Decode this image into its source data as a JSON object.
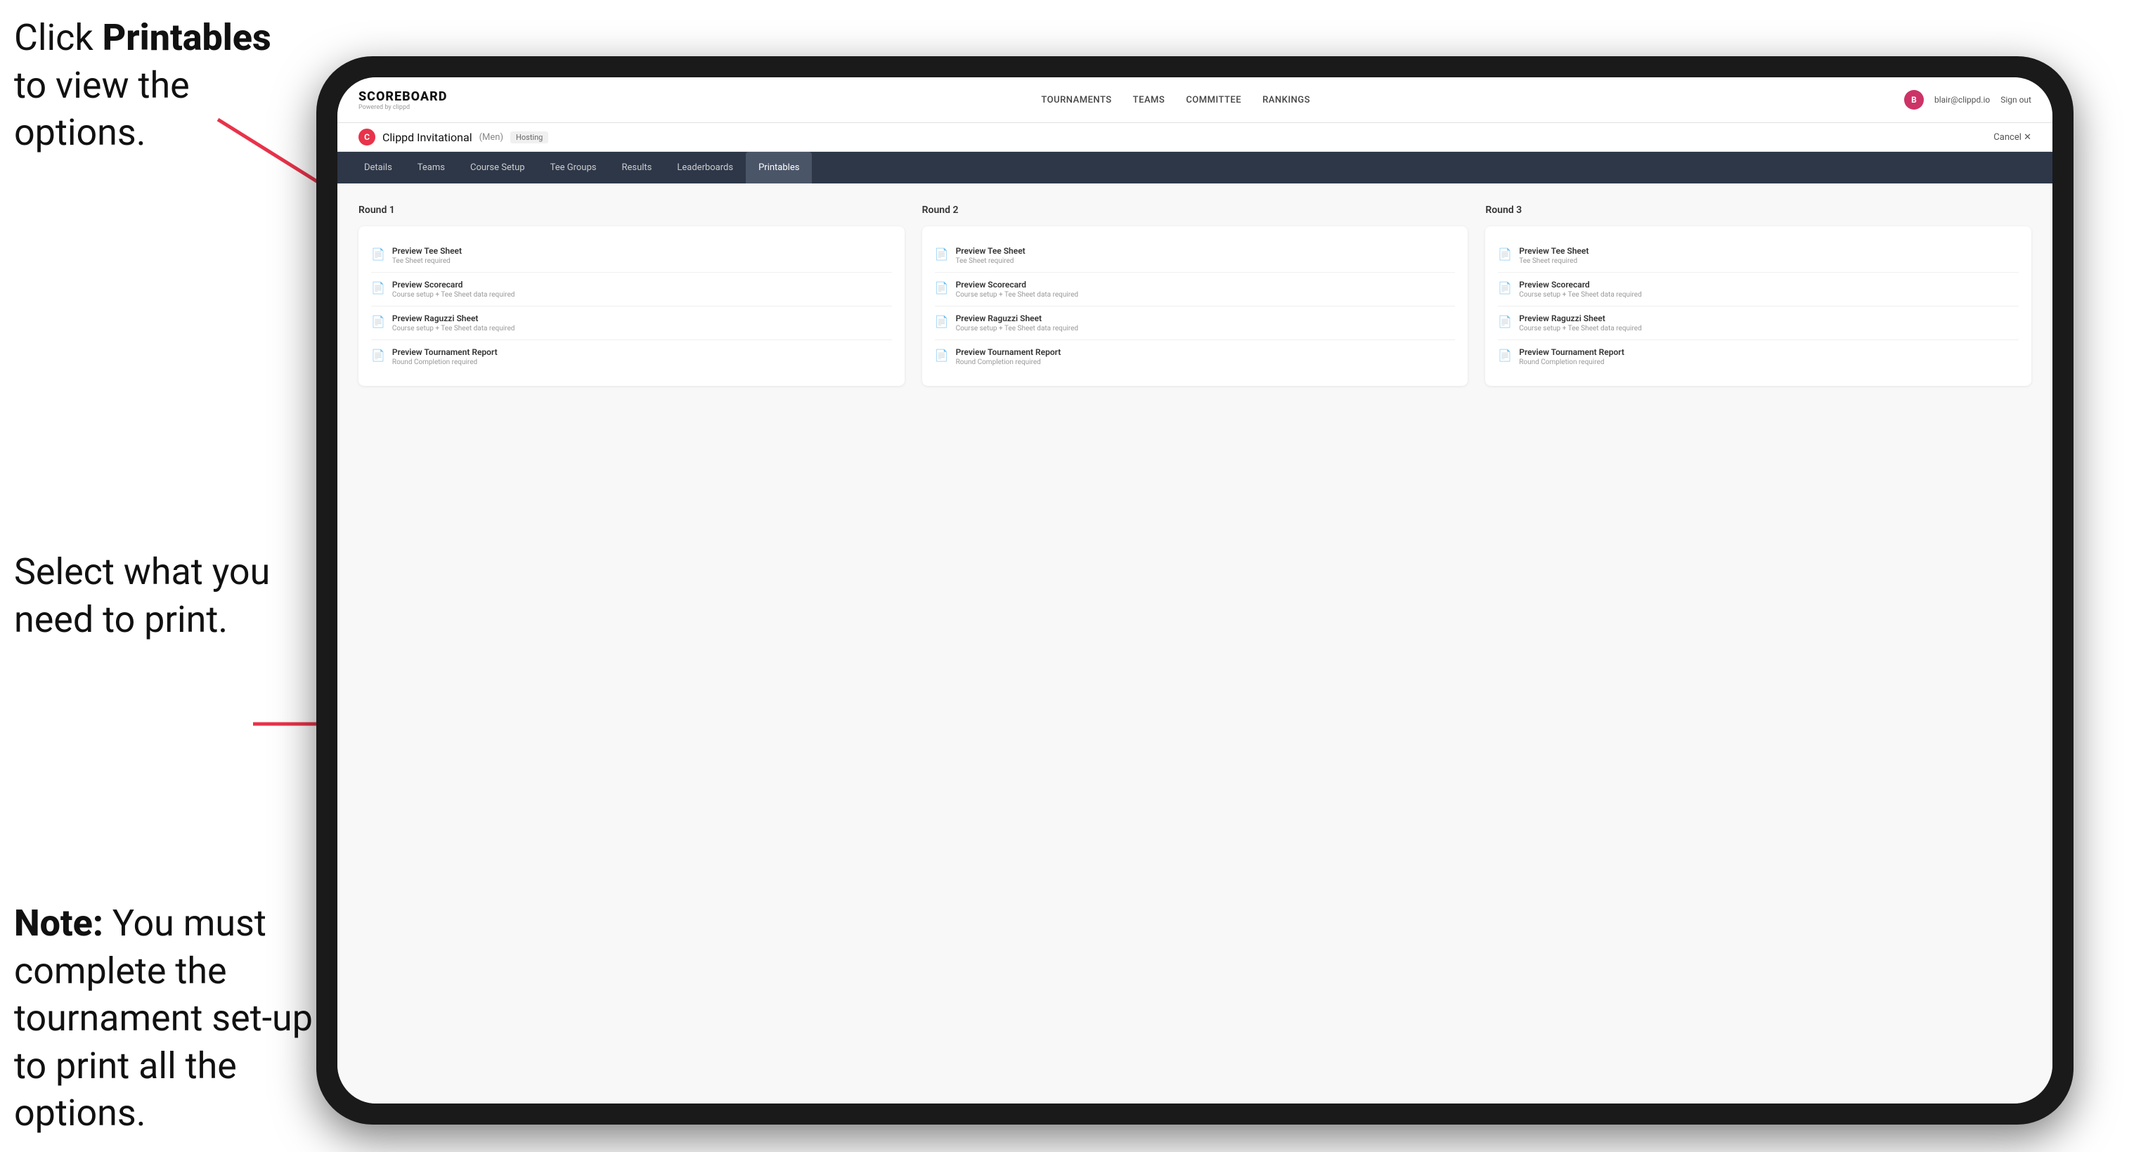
{
  "annotations": {
    "top": {
      "prefix": "Click ",
      "bold": "Printables",
      "suffix": " to view the options."
    },
    "middle": {
      "text": "Select what you need to print."
    },
    "bottom": {
      "bold": "Note:",
      "suffix": " You must complete the tournament set-up to print all the options."
    }
  },
  "nav": {
    "logo": "SCOREBOARD",
    "logo_sub": "Powered by clippd",
    "items": [
      "TOURNAMENTS",
      "TEAMS",
      "COMMITTEE",
      "RANKINGS"
    ],
    "user_email": "blair@clippd.io",
    "sign_out": "Sign out"
  },
  "tournament": {
    "name": "Clippd Invitational",
    "bracket": "(Men)",
    "status": "Hosting",
    "cancel": "Cancel  ✕"
  },
  "tabs": [
    {
      "label": "Details",
      "active": false
    },
    {
      "label": "Teams",
      "active": false
    },
    {
      "label": "Course Setup",
      "active": false
    },
    {
      "label": "Tee Groups",
      "active": false
    },
    {
      "label": "Results",
      "active": false
    },
    {
      "label": "Leaderboards",
      "active": false
    },
    {
      "label": "Printables",
      "active": true
    }
  ],
  "rounds": [
    {
      "title": "Round 1",
      "items": [
        {
          "label": "Preview Tee Sheet",
          "sublabel": "Tee Sheet required"
        },
        {
          "label": "Preview Scorecard",
          "sublabel": "Course setup + Tee Sheet data required"
        },
        {
          "label": "Preview Raguzzi Sheet",
          "sublabel": "Course setup + Tee Sheet data required"
        },
        {
          "label": "Preview Tournament Report",
          "sublabel": "Round Completion required"
        }
      ]
    },
    {
      "title": "Round 2",
      "items": [
        {
          "label": "Preview Tee Sheet",
          "sublabel": "Tee Sheet required"
        },
        {
          "label": "Preview Scorecard",
          "sublabel": "Course setup + Tee Sheet data required"
        },
        {
          "label": "Preview Raguzzi Sheet",
          "sublabel": "Course setup + Tee Sheet data required"
        },
        {
          "label": "Preview Tournament Report",
          "sublabel": "Round Completion required"
        }
      ]
    },
    {
      "title": "Round 3",
      "items": [
        {
          "label": "Preview Tee Sheet",
          "sublabel": "Tee Sheet required"
        },
        {
          "label": "Preview Scorecard",
          "sublabel": "Course setup + Tee Sheet data required"
        },
        {
          "label": "Preview Raguzzi Sheet",
          "sublabel": "Course setup + Tee Sheet data required"
        },
        {
          "label": "Preview Tournament Report",
          "sublabel": "Round Completion required"
        }
      ]
    }
  ]
}
